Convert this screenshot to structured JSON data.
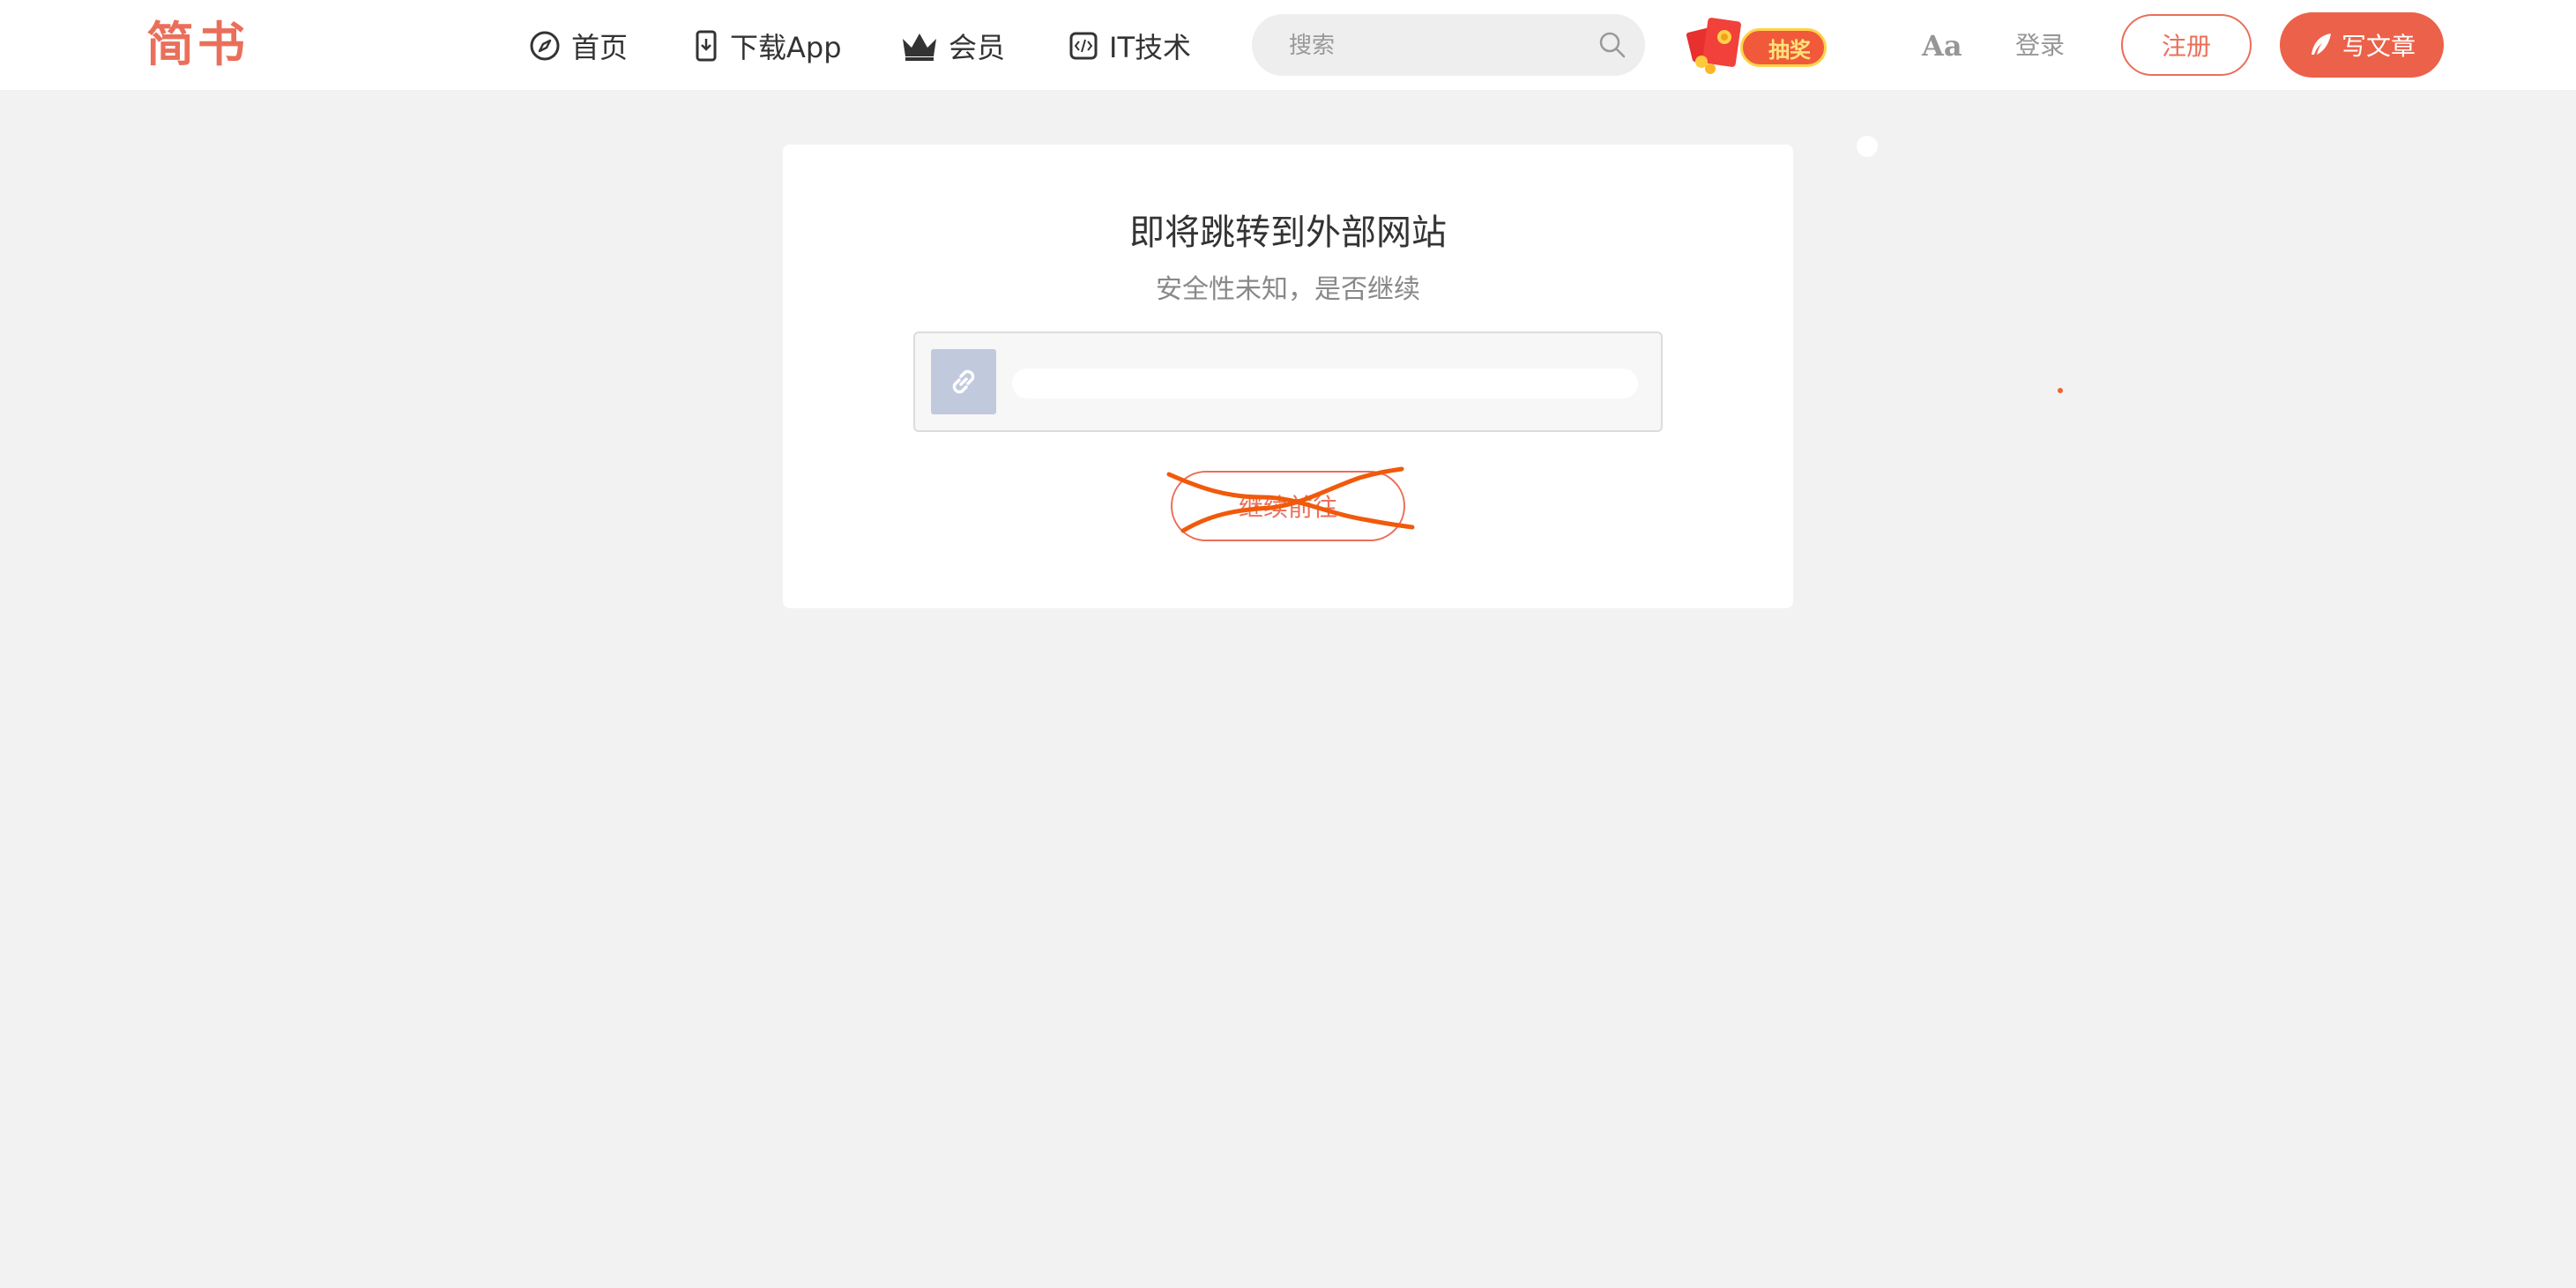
{
  "header": {
    "logo": "简书",
    "nav": [
      {
        "label": "首页",
        "icon": "compass-icon"
      },
      {
        "label": "下载App",
        "icon": "phone-download-icon"
      },
      {
        "label": "会员",
        "icon": "crown-icon"
      },
      {
        "label": "IT技术",
        "icon": "code-icon"
      }
    ],
    "search": {
      "placeholder": "搜索",
      "icon": "search-icon"
    },
    "lottery_label": "抽奖",
    "font_toggle": "Aa",
    "login_label": "登录",
    "register_label": "注册",
    "write_label": "写文章"
  },
  "dialog": {
    "title": "即将跳转到外部网站",
    "subtitle": "安全性未知，是否继续",
    "link_icon": "link-icon",
    "url": "",
    "continue_label": "继续前往"
  },
  "colors": {
    "brand": "#ea6f5a",
    "write_button": "#ec6149",
    "background": "#f2f2f2",
    "link_icon_bg": "#c1c9dd",
    "scribble": "#f05a0a"
  }
}
